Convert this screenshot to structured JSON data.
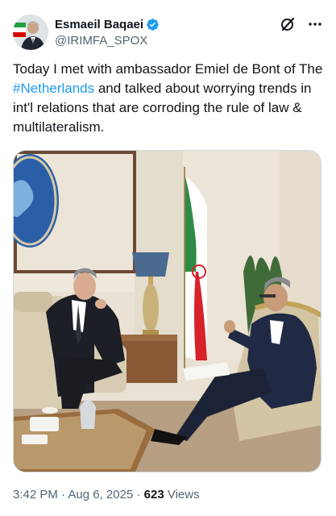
{
  "author": {
    "display_name": "Esmaeil Baqaei",
    "handle": "@IRIMFA_SPOX",
    "verified": true,
    "verified_icon": "verified-badge-icon",
    "avatar_icon": "profile-avatar"
  },
  "header_actions": {
    "grok_icon": "grok-slash-icon",
    "more_icon": "more-dots-icon"
  },
  "tweet": {
    "text_before": "Today I met with ambassador Emiel de Bont of The ",
    "hashtag": "#Netherlands",
    "text_after": " and talked about worrying trends in int'l relations that are corroding the rule of law & multilateralism."
  },
  "media": {
    "kind": "photo"
  },
  "meta": {
    "time": "3:42 PM",
    "separator1": " · ",
    "date": "Aug 6, 2025",
    "separator2": " · ",
    "views_count": "623",
    "views_label": " Views"
  },
  "colors": {
    "link": "#1d9bf0",
    "verified": "#1d9bf0",
    "secondary_text": "#536471",
    "primary_text": "#0f1419"
  }
}
